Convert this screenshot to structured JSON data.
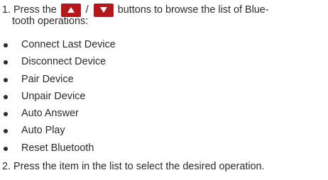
{
  "step1": {
    "prefix": "1. Press the",
    "separator": "/",
    "suffix_line1": "buttons to browse the list of Blue-",
    "suffix_line2": "tooth operations:"
  },
  "buttons": {
    "up_icon": "up-arrow-icon",
    "down_icon": "down-arrow-icon",
    "color": "#b5171d"
  },
  "operations": [
    "Connect Last Device",
    "Disconnect Device",
    "Pair Device",
    "Unpair Device",
    "Auto Answer",
    "Auto Play",
    "Reset Bluetooth"
  ],
  "step2": {
    "text": "2. Press the item in the list to select the desired operation."
  }
}
